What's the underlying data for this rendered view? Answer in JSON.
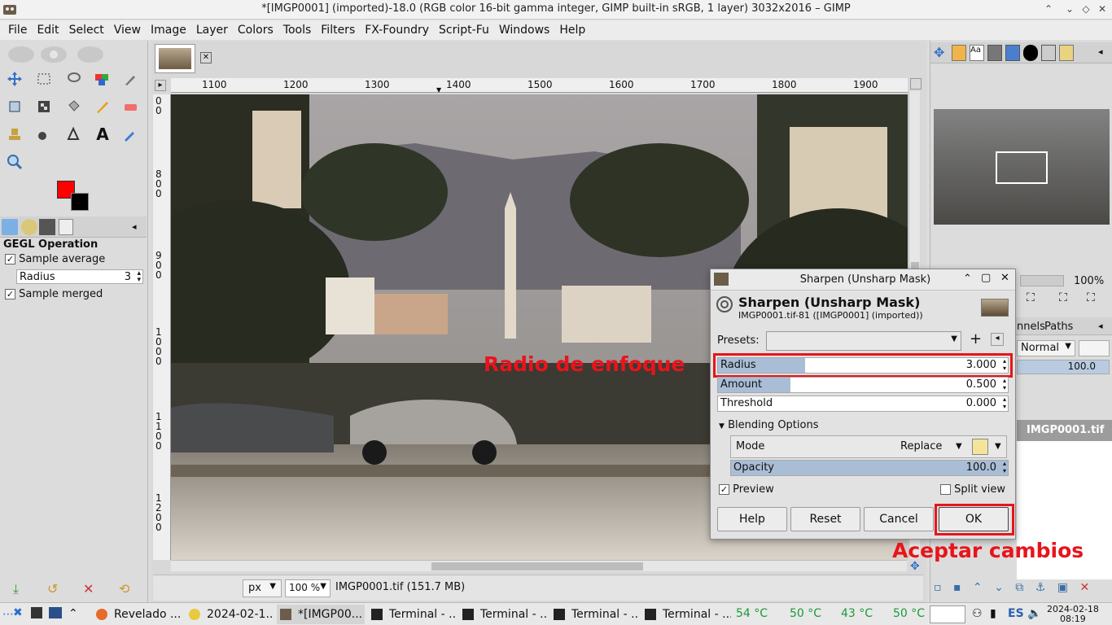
{
  "window": {
    "title": "*[IMGP0001] (imported)-18.0 (RGB color 16-bit gamma integer, GIMP built-in sRGB, 1 layer) 3032x2016 – GIMP"
  },
  "menu": [
    "File",
    "Edit",
    "Select",
    "View",
    "Image",
    "Layer",
    "Colors",
    "Tools",
    "Filters",
    "FX-Foundry",
    "Script-Fu",
    "Windows",
    "Help"
  ],
  "tool_options": {
    "title": "GEGL Operation",
    "sample_average": "Sample average",
    "radius_label": "Radius",
    "radius_value": "3",
    "sample_merged": "Sample merged"
  },
  "colors": {
    "fg": "#ff0000",
    "bg": "#000000",
    "annotation": "#e8141b"
  },
  "rulers": {
    "h": [
      "1100",
      "1200",
      "1300",
      "1400",
      "1500",
      "1600",
      "1700",
      "1800",
      "1900"
    ],
    "v": [
      "0\n0",
      "8\n0\n0",
      "9\n0\n0",
      "1\n0\n0\n0",
      "1\n1\n0\n0",
      "1\n2\n0\n0"
    ]
  },
  "status": {
    "unit": "px",
    "zoom": "100 %",
    "file": "IMGP0001.tif (151.7 MB)"
  },
  "navigator": {
    "zoom": "100%"
  },
  "layers": {
    "tab_channels": "nnels",
    "tab_paths": "Paths",
    "mode": "Normal",
    "opacity": "100.0",
    "layer_name": "IMGP0001.tif"
  },
  "dialog": {
    "title": "Sharpen (Unsharp Mask)",
    "heading": "Sharpen (Unsharp Mask)",
    "subheading": "IMGP0001.tif-81 ([IMGP0001] (imported))",
    "presets_label": "Presets:",
    "radius_label": "Radius",
    "radius_value": "3.000",
    "radius_fill": 0.3,
    "amount_label": "Amount",
    "amount_value": "0.500",
    "amount_fill": 0.25,
    "threshold_label": "Threshold",
    "threshold_value": "0.000",
    "blending": "Blending Options",
    "mode_label": "Mode",
    "mode_value": "Replace",
    "opacity_label": "Opacity",
    "opacity_value": "100.0",
    "preview": "Preview",
    "split_view": "Split view",
    "help": "Help",
    "reset": "Reset",
    "cancel": "Cancel",
    "ok": "OK"
  },
  "annotations": {
    "radius": "Radio de enfoque",
    "ok": "Aceptar cambios"
  },
  "taskbar": {
    "tasks": [
      "Revelado ...",
      "2024-02-1...",
      "*[IMGP00...",
      "Terminal - ...",
      "Terminal - ...",
      "Terminal - ...",
      "Terminal - ..."
    ],
    "temps": [
      "54 °C",
      "50 °C",
      "43 °C",
      "50 °C"
    ],
    "lang": "ES",
    "date": "2024-02-18",
    "time": "08:19"
  }
}
